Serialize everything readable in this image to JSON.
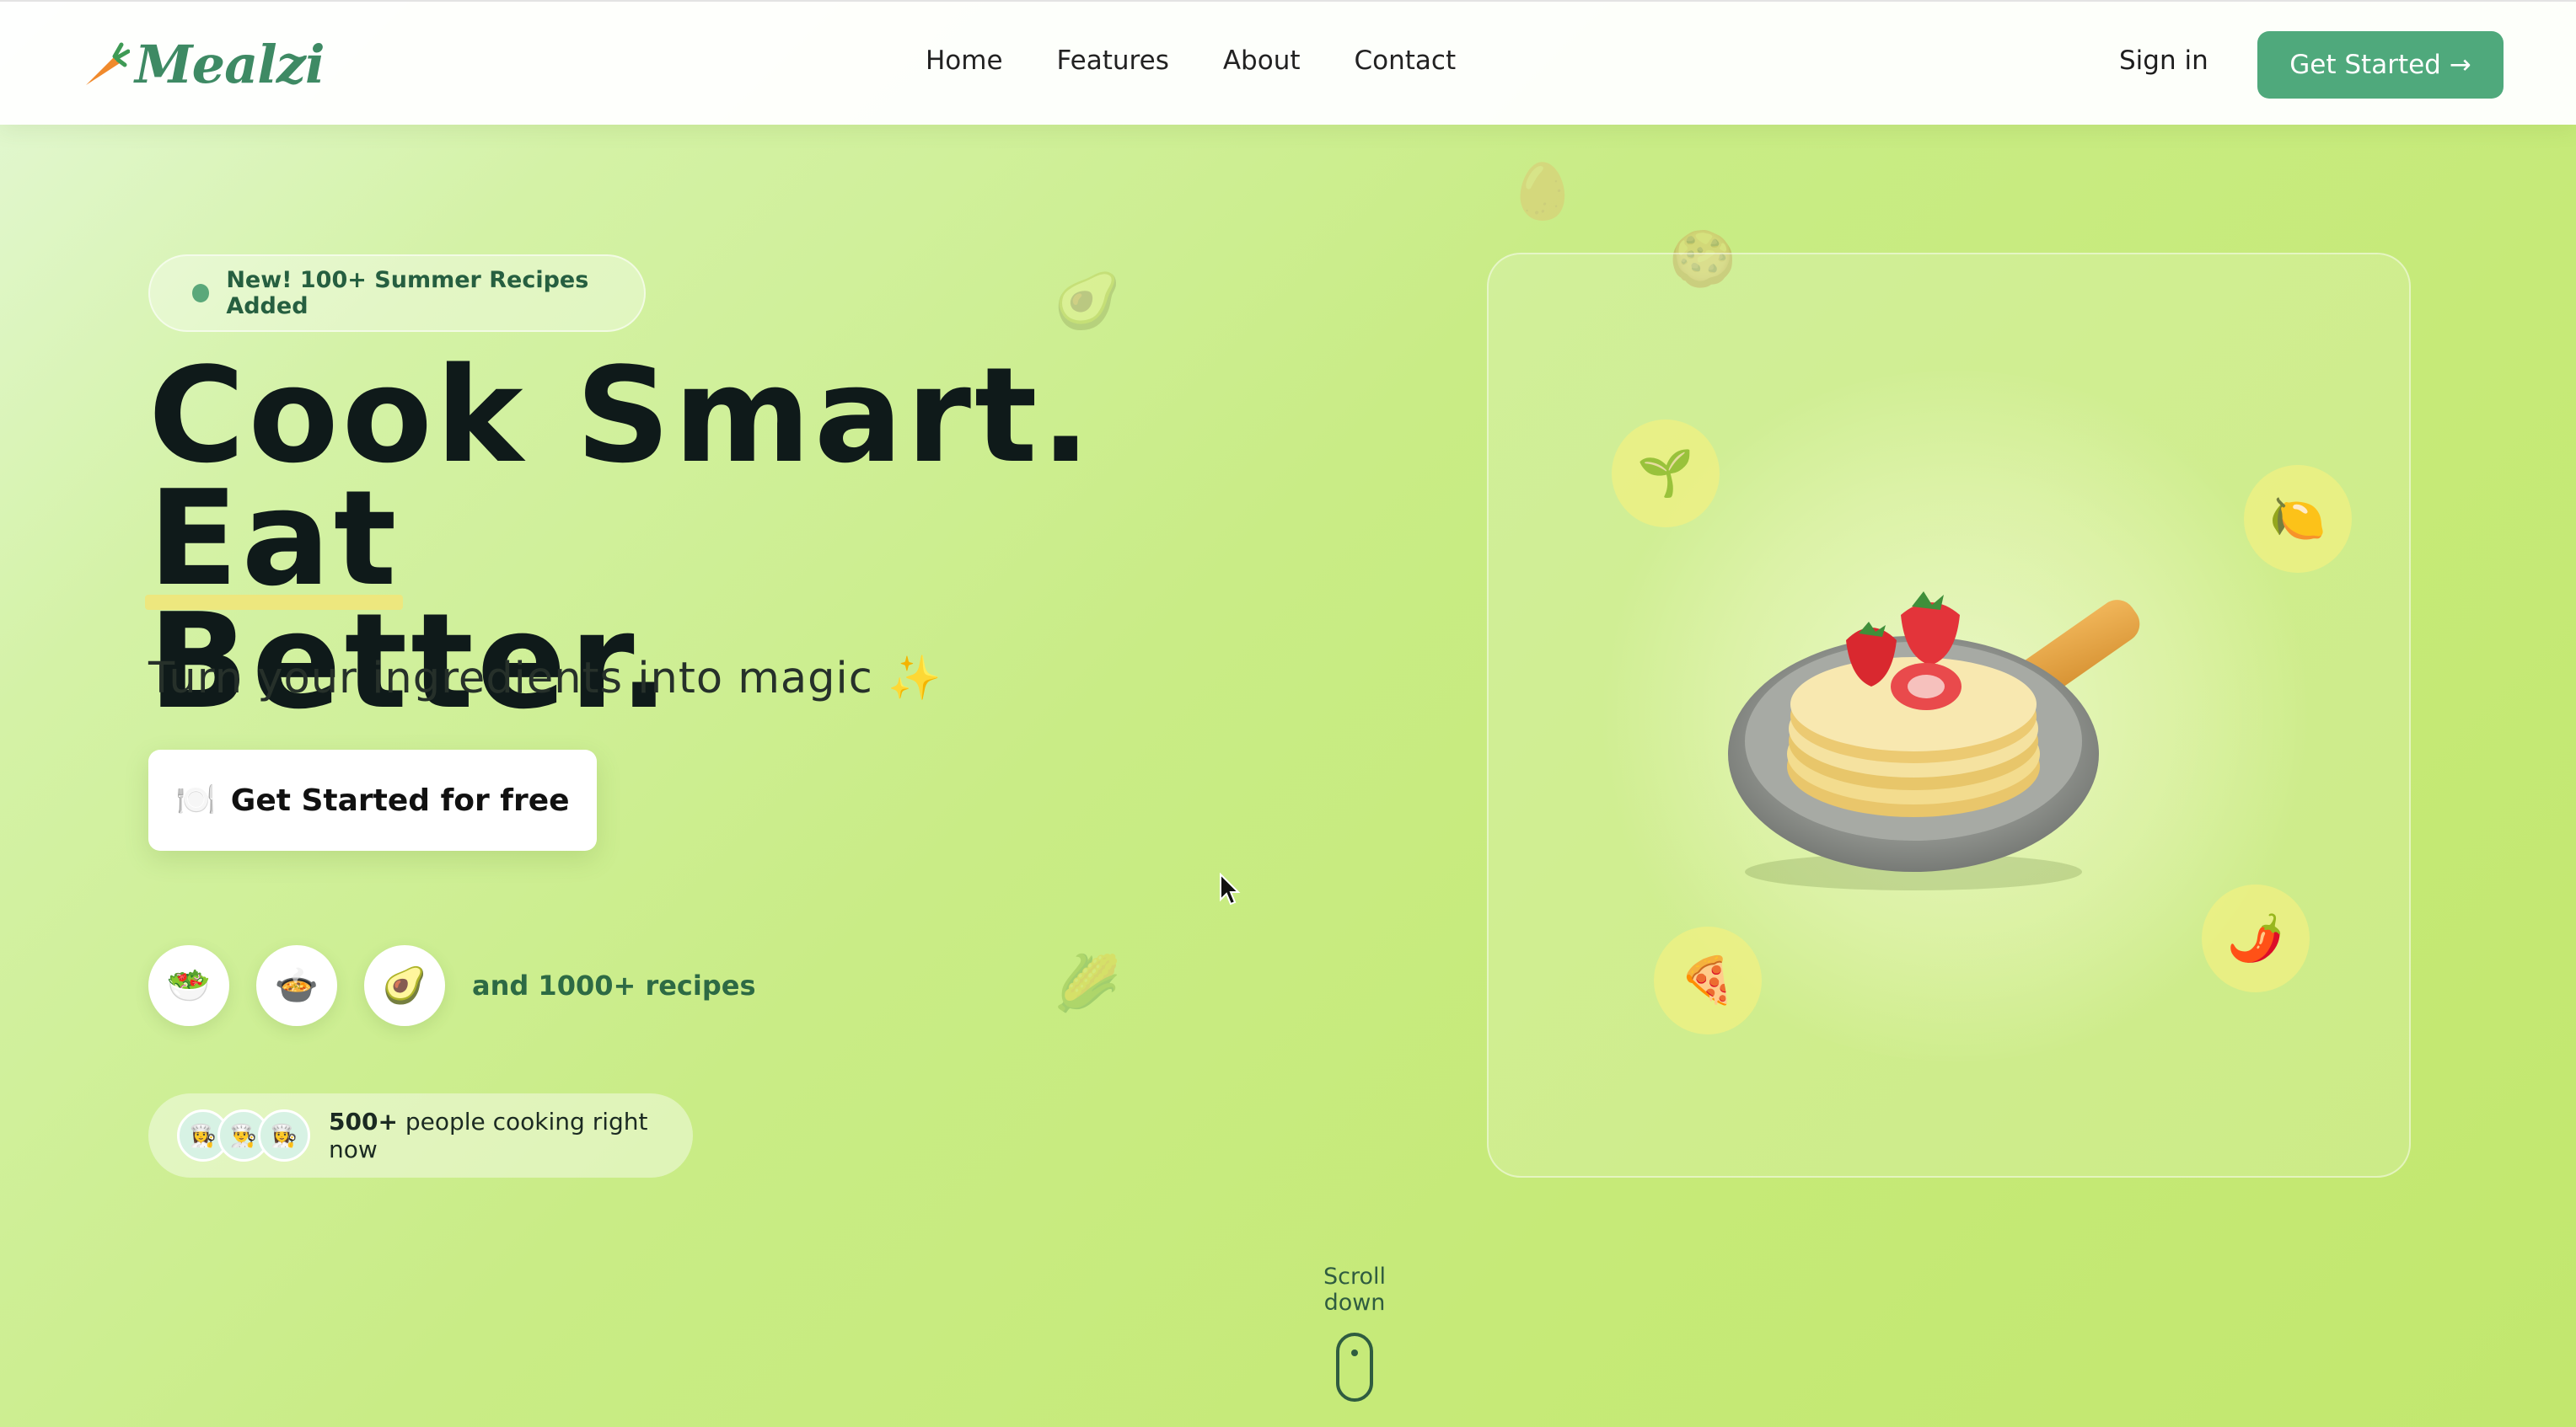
{
  "brand": {
    "name": "Mealzi",
    "logo_icon": "carrot-icon"
  },
  "nav": {
    "links": [
      "Home",
      "Features",
      "About",
      "Contact"
    ],
    "signin": "Sign in",
    "cta": "Get Started →"
  },
  "hero": {
    "badge": "New! 100+ Summer Recipes Added",
    "headline_part1": "Cook Smart.",
    "headline_highlight": "Eat",
    "headline_part2": "Better.",
    "subtitle": "Turn your ingredients into magic ✨",
    "cta_icon": "🍽️",
    "cta_label": "Get Started for free",
    "recipe_icons": [
      "🥗",
      "🍲",
      "🥑"
    ],
    "recipe_more": "and 1000+ recipes",
    "cooking_avatars": [
      "👩‍🍳",
      "👨‍🍳",
      "👩‍🍳"
    ],
    "cooking_count": "500+",
    "cooking_text": "people cooking right now"
  },
  "showcase": {
    "floating_icons": [
      "🌱",
      "🍋",
      "🍕",
      "🌶️"
    ],
    "image": "pancakes-in-pan"
  },
  "scroll": {
    "label": "Scroll down"
  },
  "colors": {
    "brand_green": "#4fa97c",
    "headline": "#0f1a1a",
    "highlight": "#f0e57a"
  }
}
